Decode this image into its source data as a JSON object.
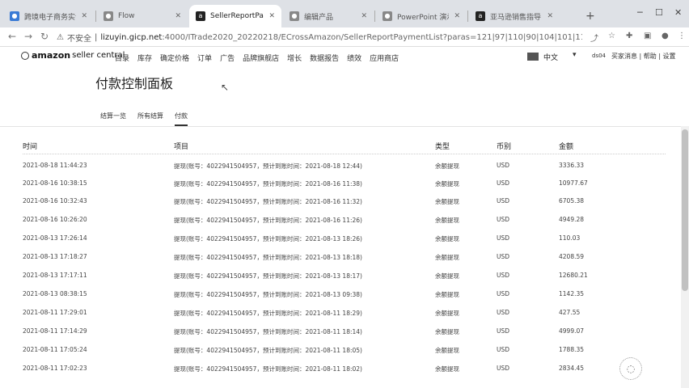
{
  "browser": {
    "tabs": [
      {
        "title": "跨境电子商务实训平…",
        "active": false,
        "icon": "globe-icon"
      },
      {
        "title": "Flow",
        "active": false,
        "icon": "globe-icon"
      },
      {
        "title": "SellerReportPayme…",
        "active": true,
        "icon": "amazon-icon"
      },
      {
        "title": "编辑产品",
        "active": false,
        "icon": "globe-icon"
      },
      {
        "title": "PowerPoint 演示文稿",
        "active": false,
        "icon": "globe-icon"
      },
      {
        "title": "亚马逊销售指导",
        "active": false,
        "icon": "amazon-icon"
      }
    ],
    "insecure_label": "不安全",
    "url_host": "lizuyin.gicp.net",
    "url_path": ":4000/ITrade2020_20220218/ECrossAmazon/SellerReportPaymentList?paras=121|97|110|90|104|101|110|103|61|50|48|52|..."
  },
  "header": {
    "logo_amazon": "amazon",
    "logo_sc": "seller central",
    "nav": [
      "目录",
      "库存",
      "确定价格",
      "订单",
      "广告",
      "品牌旗舰店",
      "增长",
      "数据报告",
      "绩效",
      "应用商店"
    ],
    "language": "中文",
    "user": "ds04",
    "links": "买家消息 | 帮助 | 设置"
  },
  "page": {
    "title": "付款控制面板",
    "subtabs": [
      {
        "label": "结算一览",
        "active": false
      },
      {
        "label": "所有结算",
        "active": false
      },
      {
        "label": "付款",
        "active": true
      }
    ]
  },
  "table": {
    "headers": {
      "time": "时间",
      "item": "项目",
      "type": "类型",
      "currency": "币别",
      "amount": "金额"
    },
    "rows": [
      {
        "time": "2021-08-18 11:44:23",
        "item": "提现(账号：4022941504957，预计到账时间：2021-08-18 12:44)",
        "type": "余额提现",
        "currency": "USD",
        "amount": "3336.33"
      },
      {
        "time": "2021-08-16 10:38:15",
        "item": "提现(账号：4022941504957，预计到账时间：2021-08-16 11:38)",
        "type": "余额提现",
        "currency": "USD",
        "amount": "10977.67"
      },
      {
        "time": "2021-08-16 10:32:43",
        "item": "提现(账号：4022941504957，预计到账时间：2021-08-16 11:32)",
        "type": "余额提现",
        "currency": "USD",
        "amount": "6705.38"
      },
      {
        "time": "2021-08-16 10:26:20",
        "item": "提现(账号：4022941504957，预计到账时间：2021-08-16 11:26)",
        "type": "余额提现",
        "currency": "USD",
        "amount": "4949.28"
      },
      {
        "time": "2021-08-13 17:26:14",
        "item": "提现(账号：4022941504957，预计到账时间：2021-08-13 18:26)",
        "type": "余额提现",
        "currency": "USD",
        "amount": "110.03"
      },
      {
        "time": "2021-08-13 17:18:27",
        "item": "提现(账号：4022941504957，预计到账时间：2021-08-13 18:18)",
        "type": "余额提现",
        "currency": "USD",
        "amount": "4208.59"
      },
      {
        "time": "2021-08-13 17:17:11",
        "item": "提现(账号：4022941504957，预计到账时间：2021-08-13 18:17)",
        "type": "余额提现",
        "currency": "USD",
        "amount": "12680.21"
      },
      {
        "time": "2021-08-13 08:38:15",
        "item": "提现(账号：4022941504957，预计到账时间：2021-08-13 09:38)",
        "type": "余额提现",
        "currency": "USD",
        "amount": "1142.35"
      },
      {
        "time": "2021-08-11 17:29:01",
        "item": "提现(账号：4022941504957，预计到账时间：2021-08-11 18:29)",
        "type": "余额提现",
        "currency": "USD",
        "amount": "427.55"
      },
      {
        "time": "2021-08-11 17:14:29",
        "item": "提现(账号：4022941504957，预计到账时间：2021-08-11 18:14)",
        "type": "余额提现",
        "currency": "USD",
        "amount": "4999.07"
      },
      {
        "time": "2021-08-11 17:05:24",
        "item": "提现(账号：4022941504957，预计到账时间：2021-08-11 18:05)",
        "type": "余额提现",
        "currency": "USD",
        "amount": "1788.35"
      },
      {
        "time": "2021-08-11 17:02:23",
        "item": "提现(账号：4022941504957，预计到账时间：2021-08-11 18:02)",
        "type": "余额提现",
        "currency": "USD",
        "amount": "2834.45"
      }
    ]
  }
}
